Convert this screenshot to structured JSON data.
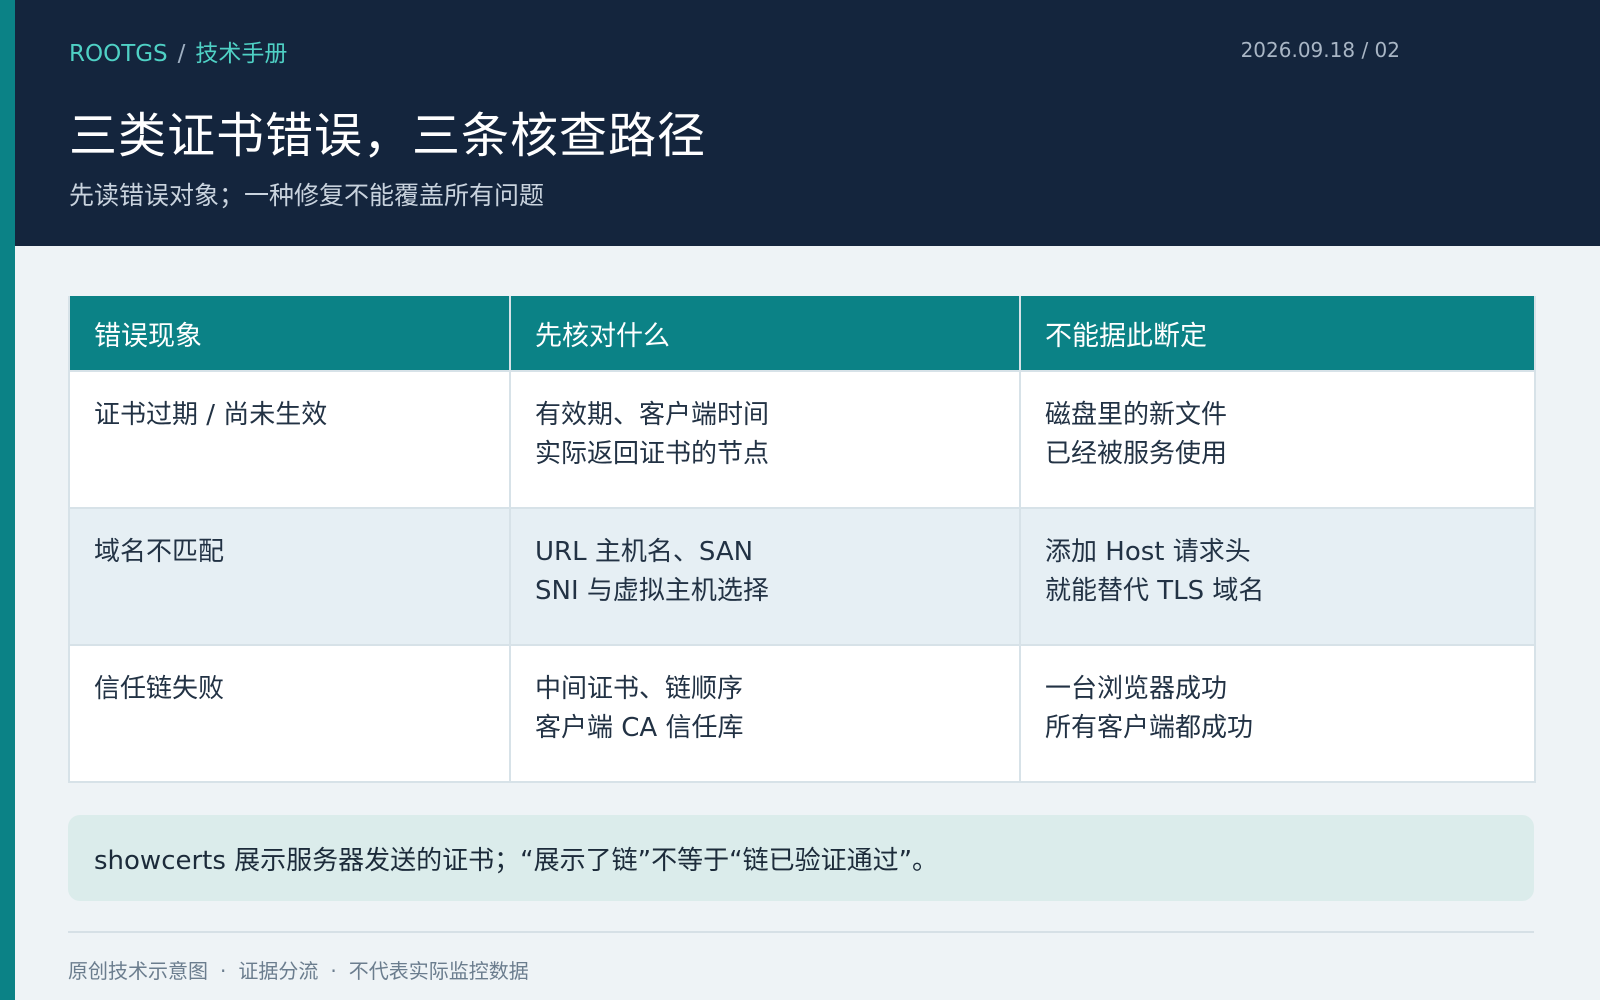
{
  "header": {
    "brand": "ROOTGS",
    "separator": "/",
    "section": "技术手册",
    "date_page": "2026.09.18 / 02",
    "title": "三类证书错误，三条核查路径",
    "subtitle": "先读错误对象；一种修复不能覆盖所有问题"
  },
  "table": {
    "headers": [
      "错误现象",
      "先核对什么",
      "不能据此断定"
    ],
    "rows": [
      {
        "symptom": "证书过期 / 尚未生效",
        "check": [
          "有效期、客户端时间",
          "实际返回证书的节点"
        ],
        "not_conclude": [
          "磁盘里的新文件",
          "已经被服务使用"
        ]
      },
      {
        "symptom": "域名不匹配",
        "check": [
          "URL 主机名、SAN",
          "SNI 与虚拟主机选择"
        ],
        "not_conclude": [
          "添加 Host 请求头",
          "就能替代 TLS 域名"
        ]
      },
      {
        "symptom": "信任链失败",
        "check": [
          "中间证书、链顺序",
          "客户端 CA 信任库"
        ],
        "not_conclude": [
          "一台浏览器成功",
          "所有客户端都成功"
        ]
      }
    ]
  },
  "note": "showcerts 展示服务器发送的证书；“展示了链”不等于“链已验证通过”。",
  "footer": {
    "items": [
      "原创技术示意图",
      "证据分流",
      "不代表实际监控数据"
    ],
    "dot": "·"
  },
  "colors": {
    "header_bg": "#14253d",
    "accent": "#0b8286",
    "breadcrumb": "#4fd1c5",
    "note_bg": "#dbeceb"
  }
}
